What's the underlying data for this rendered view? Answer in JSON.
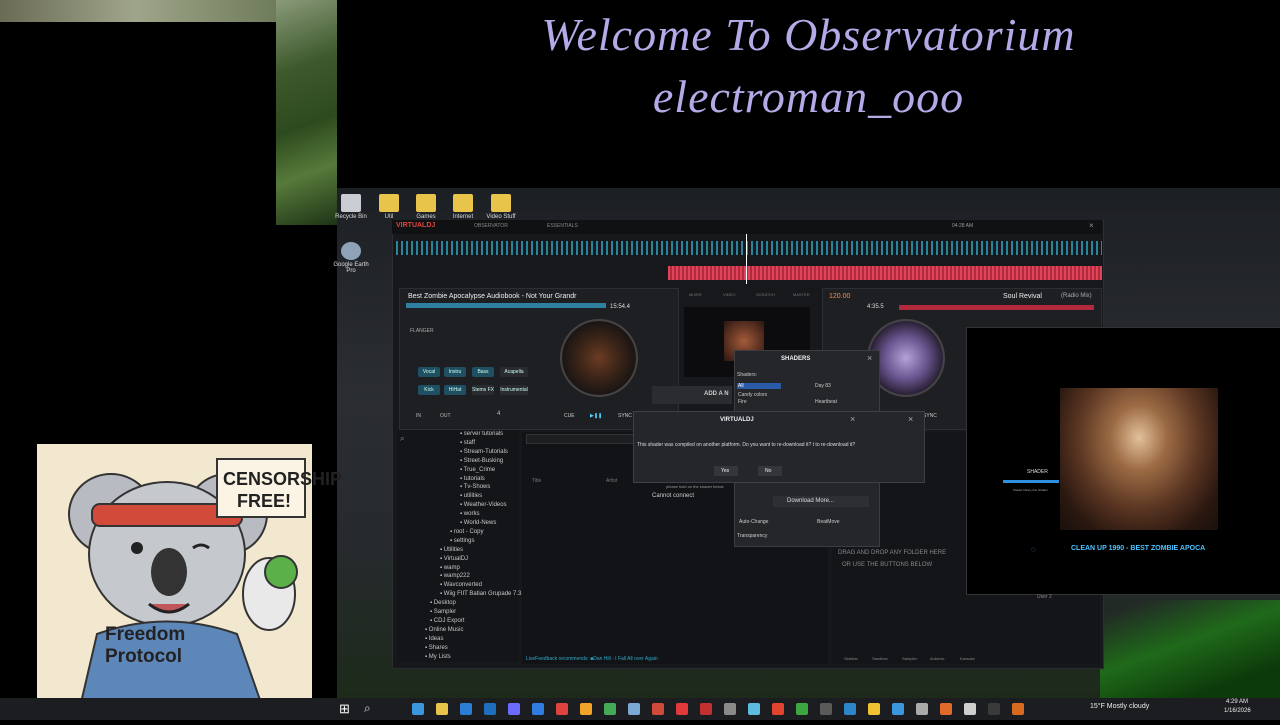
{
  "banner": {
    "line1": "Welcome To Observatorium",
    "line2": "electroman_ooo"
  },
  "desktop_icons": [
    {
      "label": "Recycle Bin",
      "color": "#c9ccd2"
    },
    {
      "label": "Util",
      "color": "#e8c54a"
    },
    {
      "label": "Games",
      "color": "#e8c54a"
    },
    {
      "label": "Internet",
      "color": "#e8c54a"
    },
    {
      "label": "Video Stuff",
      "color": "#e8c54a"
    },
    {
      "label": "Google Earth Pro",
      "color": "#8fa3b8"
    }
  ],
  "vdj": {
    "logo": "VIRTUALDJ",
    "top_tabs": [
      "OBSERVATOR",
      "ESSENTIALS"
    ],
    "time": "04:28 AM",
    "deck_left": {
      "title": "Best Zombie Apocalypse Audiobook - Not Your Grandr",
      "remaining": "15:54.4",
      "effect": "FLANGER",
      "stem_buttons": [
        "Vocal",
        "Instru",
        "Bass",
        "Acapella",
        "Kick",
        "HiHat",
        "Stems FX",
        "Instrumental"
      ],
      "loop": "4",
      "cue": "CUE",
      "play": "▶❚❚",
      "sync": "SYNC",
      "in": "IN",
      "out": "OUT"
    },
    "deck_right": {
      "title": "Soul Revival",
      "subtitle": "(Radio Mix)",
      "bpm": "120.00",
      "remaining": "4:35.5",
      "sync": "SYNC"
    },
    "center_tabs": [
      "MIXER",
      "VIDEO",
      "SCRATCH",
      "MASTER"
    ],
    "folders": [
      "server tutorials",
      "staff",
      "Stream-Tutorials",
      "Street-Busking",
      "True_Crime",
      "tutorials",
      "Tv-Shows",
      "utilities",
      "Weather-Videos",
      "works",
      "World-News",
      "root - Copy",
      "settings",
      "Utilities",
      "VirtualDJ",
      "wamp",
      "wamp222",
      "Wavconverted",
      "Wiig FIIT Batian Grupade 7.3.5",
      "Desktop",
      "Sampler",
      "CDJ Export",
      "Online Music",
      "Ideas",
      "Shares",
      "My Lists"
    ],
    "list_headers": {
      "title": "Title",
      "artist": "Artist"
    },
    "drop_hint1": "DRAG AND DROP ANY FOLDER HERE",
    "drop_hint2": "OR USE THE BUTTONS BELOW",
    "status_bar": "LiveFeedback recommends: ■Dan Hill - I Fall All over Again",
    "bottom_tabs": [
      "Sidebar",
      "Sandbox",
      "Sampler",
      "Automix",
      "Karaoke"
    ],
    "user_label": "User 2"
  },
  "shaders_dialog": {
    "title": "SHADERS",
    "shaders_label": "Shaders:",
    "categories": [
      "All",
      "Candy colors",
      "Fire"
    ],
    "items": [
      "Day 83",
      "Heartbeat"
    ],
    "hint": "please hold on the shader below",
    "cannot_connect": "Cannot connect",
    "download_more": "Download More...",
    "auto_change": "Auto-Change",
    "beat_move": "BeatMove",
    "transparency": "Transparency",
    "add_button": "ADD A N"
  },
  "vdj_dialog": {
    "title": "VIRTUALDJ",
    "message": "This shader was compiled on another platform. Do you want to re-download it?  t to re-download it?",
    "yes": "Yes",
    "no": "No"
  },
  "preview": {
    "shader_label": "SHADER",
    "shader_sub": "Shader library fine Shader",
    "caption": "CLEAN UP 1990 - BEST ZOMBIE APOCA"
  },
  "sticker": {
    "speech": "CENSORSHIP FREE!",
    "hoodie_line1": "Freedom",
    "hoodie_line2": "Protocol"
  },
  "taskbar": {
    "weather": "15°F  Mostly cloudy",
    "time": "4:29 AM",
    "date": "1/16/2026",
    "app_colors": [
      "#3a96dd",
      "#e8c54a",
      "#2a7fd4",
      "#1f6fbf",
      "#6b6bff",
      "#2f7de1",
      "#e0443e",
      "#f0a52a",
      "#44aa55",
      "#7aa9d6",
      "#d04a3a",
      "#e03a3a",
      "#c23030",
      "#8a8a8a",
      "#5dbbe0",
      "#e2442f",
      "#3ea640",
      "#5a5a5a",
      "#2d86c9",
      "#f1c232",
      "#3a96dd",
      "#aaaaaa",
      "#e06a2a",
      "#cfcfcf",
      "#3a3a3a",
      "#d86a20"
    ]
  }
}
